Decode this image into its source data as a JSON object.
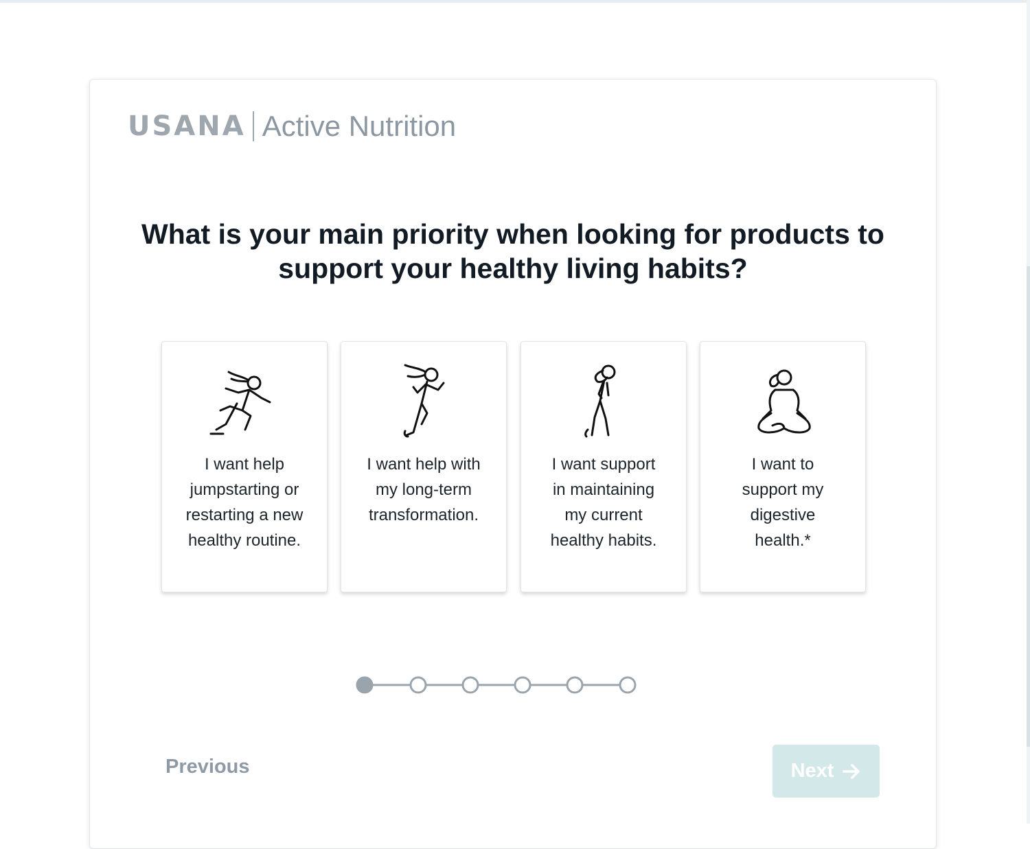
{
  "brand": {
    "logo_text": "USANA",
    "product": "Active Nutrition"
  },
  "question": {
    "line1": "What is your main priority when looking for products to",
    "line2": "support your healthy living habits?"
  },
  "options": [
    {
      "icon": "running-woman-icon",
      "lines": [
        "I want help",
        "jumpstarting or",
        "restarting a new",
        "healthy routine."
      ]
    },
    {
      "icon": "jogging-woman-icon",
      "lines": [
        "I want help with",
        "my long-term",
        "transformation."
      ]
    },
    {
      "icon": "walking-woman-icon",
      "lines": [
        "I want support",
        "in maintaining",
        "my current",
        "healthy habits."
      ]
    },
    {
      "icon": "meditating-woman-icon",
      "lines": [
        "I want to",
        "support my",
        "digestive",
        "health.*"
      ]
    }
  ],
  "progress": {
    "current_step": 1,
    "total_steps": 6
  },
  "nav": {
    "previous_label": "Previous",
    "next_label": "Next"
  },
  "colors": {
    "next_button_bg": "#d3e8e9",
    "previous_text": "#8d9aa6",
    "stepper": "#9aa4ad",
    "heading": "#121b24"
  }
}
